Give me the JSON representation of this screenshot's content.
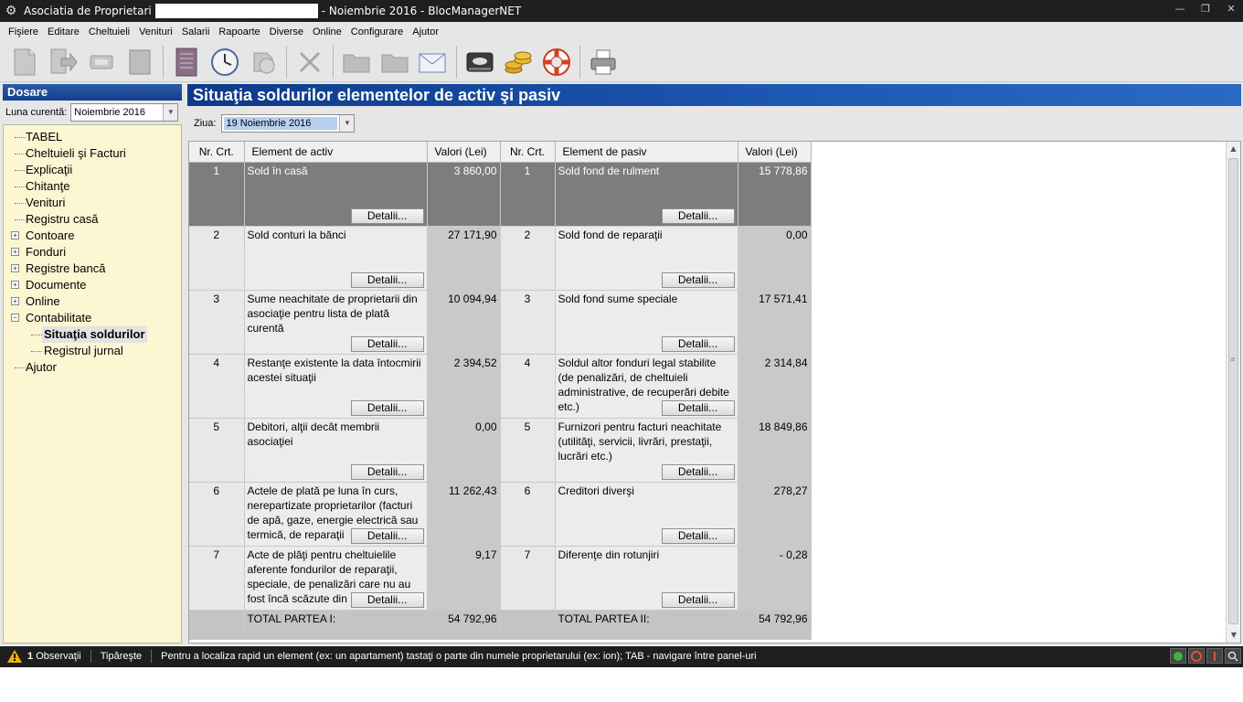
{
  "window": {
    "title_prefix": "Asociatia de Proprietari",
    "title_suffix": "- Noiembrie 2016 - BlocManagerNET"
  },
  "menu": [
    "Fişiere",
    "Editare",
    "Cheltuieli",
    "Venituri",
    "Salarii",
    "Rapoarte",
    "Diverse",
    "Online",
    "Configurare",
    "Ajutor"
  ],
  "sidebar": {
    "header": "Dosare",
    "luna_label": "Luna curentă:",
    "luna_value": "Noiembrie 2016",
    "tree": [
      {
        "label": "TABEL"
      },
      {
        "label": "Cheltuieli şi Facturi"
      },
      {
        "label": "Explicaţii"
      },
      {
        "label": "Chitanţe"
      },
      {
        "label": "Venituri"
      },
      {
        "label": "Registru casă"
      },
      {
        "label": "Contoare"
      },
      {
        "label": "Fonduri"
      },
      {
        "label": "Registre bancă"
      },
      {
        "label": "Documente"
      },
      {
        "label": "Online"
      },
      {
        "label": "Contabilitate"
      },
      {
        "label": "Situaţia soldurilor"
      },
      {
        "label": "Registrul jurnal"
      },
      {
        "label": "Ajutor"
      }
    ]
  },
  "main": {
    "title": "Situaţia soldurilor elementelor de activ şi pasiv",
    "ziua_label": "Ziua:",
    "ziua_value": "19 Noiembrie 2016",
    "columns": {
      "nr": "Nr. Crt.",
      "activ": "Element de activ",
      "val_activ": "Valori (Lei)",
      "nr2": "Nr. Crt.",
      "pasiv": "Element de pasiv",
      "val_pasiv": "Valori (Lei)"
    },
    "detalii_label": "Detalii...",
    "rows": [
      {
        "nr": "1",
        "activ": "Sold în casă",
        "val_activ": "3 860,00",
        "nr2": "1",
        "pasiv": "Sold fond de rulment",
        "val_pasiv": "15 778,86"
      },
      {
        "nr": "2",
        "activ": "Sold conturi la bănci",
        "val_activ": "27 171,90",
        "nr2": "2",
        "pasiv": "Sold fond de reparaţii",
        "val_pasiv": "0,00"
      },
      {
        "nr": "3",
        "activ": "Sume neachitate de proprietarii din asociaţie pentru lista de plată curentă",
        "val_activ": "10 094,94",
        "nr2": "3",
        "pasiv": "Sold fond sume speciale",
        "val_pasiv": "17 571,41"
      },
      {
        "nr": "4",
        "activ": "Restanţe existente la data întocmirii acestei situaţii",
        "val_activ": "2 394,52",
        "nr2": "4",
        "pasiv": "Soldul altor fonduri legal stabilite (de penalizări, de cheltuieli administrative, de recuperări debite etc.)",
        "val_pasiv": "2 314,84"
      },
      {
        "nr": "5",
        "activ": "Debitori, alţii decât membrii asociaţiei",
        "val_activ": "0,00",
        "nr2": "5",
        "pasiv": "Furnizori pentru facturi neachitate (utilităţi, servicii, livrări, prestaţii, lucrări etc.)",
        "val_pasiv": "18 849,86"
      },
      {
        "nr": "6",
        "activ": "Actele de plată pe luna în curs, nerepartizate proprietarilor (facturi de apă, gaze, energie electrică sau termică, de reparaţii",
        "val_activ": "11 262,43",
        "nr2": "6",
        "pasiv": "Creditori diverşi",
        "val_pasiv": "278,27"
      },
      {
        "nr": "7",
        "activ": "Acte de plăţi pentru cheltuielile aferente fondurilor de reparaţii, speciale, de penalizări care nu au fost încă scăzute din",
        "val_activ": "9,17",
        "nr2": "7",
        "pasiv": "Diferenţe din rotunjiri",
        "val_pasiv": "- 0,28"
      }
    ],
    "total": {
      "activ_label": "TOTAL PARTEA I:",
      "activ_value": "54 792,96",
      "pasiv_label": "TOTAL PARTEA II:",
      "pasiv_value": "54 792,96"
    }
  },
  "status": {
    "obs_count": "1",
    "obs_label": "Observaţii",
    "print_label": "Tipăreşte",
    "hint": "Pentru a localiza rapid un element (ex: un apartament) tastaţi o parte din numele proprietarului (ex: ion); TAB - navigare între panel-uri"
  }
}
